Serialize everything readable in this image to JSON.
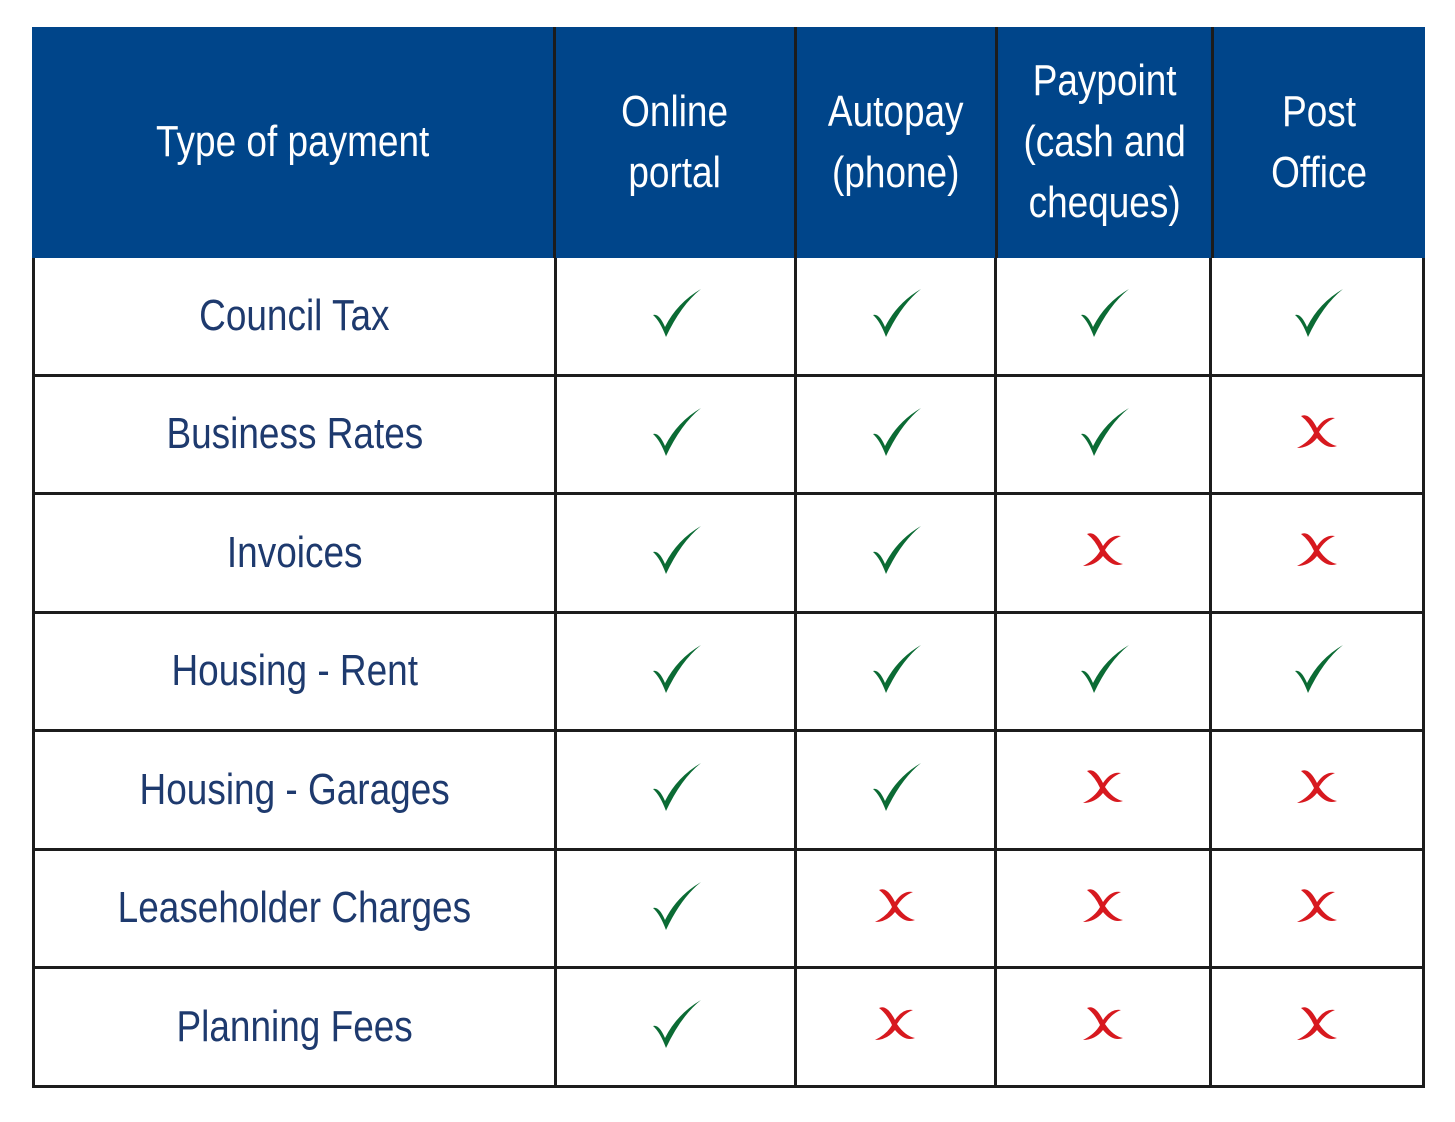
{
  "table": {
    "headers": [
      "Type of payment",
      "Online\nportal",
      "Autopay\n(phone)",
      "Paypoint\n(cash and\ncheques)",
      "Post\nOffice"
    ],
    "rows": [
      {
        "type": "Council Tax",
        "values": [
          true,
          true,
          true,
          true
        ]
      },
      {
        "type": "Business Rates",
        "values": [
          true,
          true,
          true,
          false
        ]
      },
      {
        "type": "Invoices",
        "values": [
          true,
          true,
          false,
          false
        ]
      },
      {
        "type": "Housing - Rent",
        "values": [
          true,
          true,
          true,
          true
        ]
      },
      {
        "type": "Housing - Garages",
        "values": [
          true,
          true,
          false,
          false
        ]
      },
      {
        "type": "Leaseholder Charges",
        "values": [
          true,
          false,
          false,
          false
        ]
      },
      {
        "type": "Planning Fees",
        "values": [
          true,
          false,
          false,
          false
        ]
      }
    ],
    "icons": {
      "yes": "checkmark-icon",
      "no": "cross-icon"
    },
    "colors": {
      "header_bg": "#00458a",
      "check": "#0b6b34",
      "cross": "#d7191f",
      "label": "#1e3a6e"
    }
  }
}
